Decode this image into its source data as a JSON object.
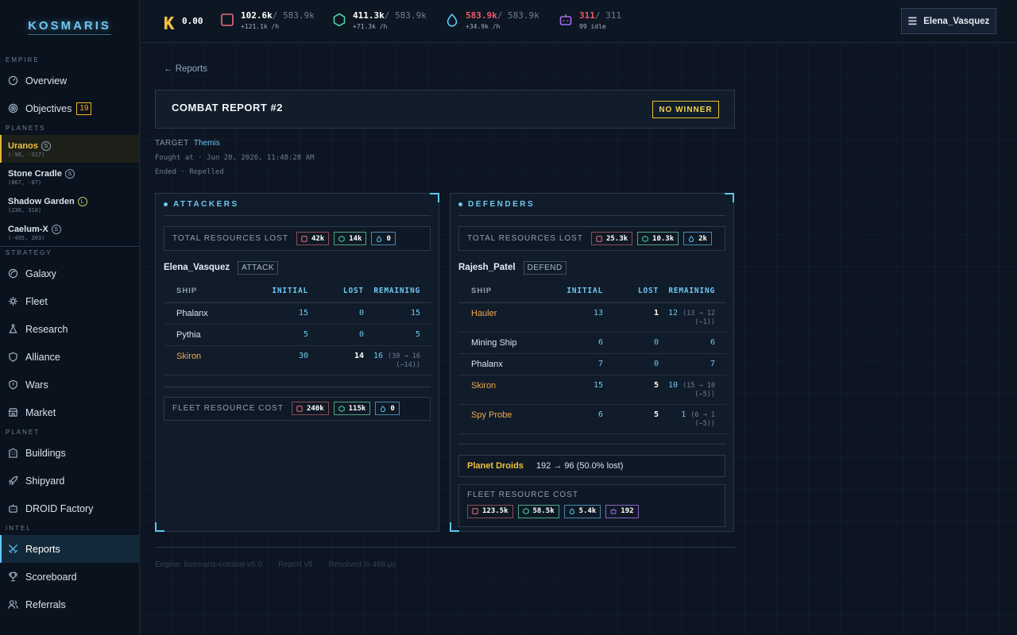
{
  "app": {
    "logo": "KOSMARIS"
  },
  "sidebar": {
    "sections": {
      "empire": "EMPIRE",
      "planets": "PLANETS",
      "strategy": "STRATEGY",
      "planet": "PLANET",
      "intel": "INTEL"
    },
    "overview": "Overview",
    "objectives": "Objectives",
    "objectives_badge": "19",
    "planets": [
      {
        "name": "Uranos",
        "size": "S",
        "coords": "(-96, -317)"
      },
      {
        "name": "Stone Cradle",
        "size": "S",
        "coords": "(867, -87)"
      },
      {
        "name": "Shadow Garden",
        "size": "L",
        "coords": "(230, 318)"
      },
      {
        "name": "Caelum-X",
        "size": "S",
        "coords": "(-495, 203)"
      }
    ],
    "strategy": [
      "Galaxy",
      "Fleet",
      "Research",
      "Alliance",
      "Wars",
      "Market"
    ],
    "planet_items": [
      "Buildings",
      "Shipyard",
      "DROID Factory"
    ],
    "intel": [
      "Reports",
      "Scoreboard",
      "Referrals"
    ]
  },
  "topbar": {
    "credits": "0.00",
    "metal": {
      "value": "102.6k",
      "cap": "/ 583.9k",
      "rate": "+121.1k /h"
    },
    "crystal": {
      "value": "411.3k",
      "cap": "/ 583.9k",
      "rate": "+71.3k /h"
    },
    "fuel": {
      "value": "583.9k",
      "cap": "/ 583.9k",
      "rate": "+34.9k /h"
    },
    "droids": {
      "value": "311",
      "cap": "/ 311",
      "rate": "99 idle"
    },
    "user": "Elena_Vasquez"
  },
  "report": {
    "back": "← Reports",
    "title": "COMBAT REPORT #2",
    "result": "NO WINNER",
    "target_label": "TARGET",
    "target": "Themis",
    "fought": "Fought at · Jun 20, 2026, 11:48:28 AM",
    "ended": "Ended · Repelled",
    "attackers": {
      "heading": "ATTACKERS",
      "lost_label": "TOTAL RESOURCES LOST",
      "lost": [
        "42k",
        "14k",
        "0"
      ],
      "player": "Elena_Vasquez",
      "role": "ATTACK",
      "cols": [
        "SHIP",
        "INITIAL",
        "LOST",
        "REMAINING"
      ],
      "rows": [
        {
          "ship": "Phalanx",
          "initial": "15",
          "lost": "0",
          "remaining": "15",
          "detail": "",
          "hl": false
        },
        {
          "ship": "Pythia",
          "initial": "5",
          "lost": "0",
          "remaining": "5",
          "detail": "",
          "hl": false
        },
        {
          "ship": "Skiron",
          "initial": "30",
          "lost": "14",
          "remaining": "16",
          "detail": "(30 → 16 (−14))",
          "hl": true
        }
      ],
      "cost_label": "FLEET RESOURCE COST",
      "cost": [
        "240k",
        "115k",
        "0"
      ]
    },
    "defenders": {
      "heading": "DEFENDERS",
      "lost_label": "TOTAL RESOURCES LOST",
      "lost": [
        "25.3k",
        "10.3k",
        "2k"
      ],
      "player": "Rajesh_Patel",
      "role": "DEFEND",
      "cols": [
        "SHIP",
        "INITIAL",
        "LOST",
        "REMAINING"
      ],
      "rows": [
        {
          "ship": "Hauler",
          "initial": "13",
          "lost": "1",
          "remaining": "12",
          "detail": "(13 → 12 (−1))",
          "hl": true
        },
        {
          "ship": "Mining Ship",
          "initial": "6",
          "lost": "0",
          "remaining": "6",
          "detail": "",
          "hl": false
        },
        {
          "ship": "Phalanx",
          "initial": "7",
          "lost": "0",
          "remaining": "7",
          "detail": "",
          "hl": false
        },
        {
          "ship": "Skiron",
          "initial": "15",
          "lost": "5",
          "remaining": "10",
          "detail": "(15 → 10 (−5))",
          "hl": true
        },
        {
          "ship": "Spy Probe",
          "initial": "6",
          "lost": "5",
          "remaining": "1",
          "detail": "(6 → 1 (−5))",
          "hl": true
        }
      ],
      "droids_label": "Planet Droids",
      "droids_value": "192 → 96 (50.0% lost)",
      "cost_label": "FLEET RESOURCE COST",
      "cost": [
        "123.5k",
        "58.5k",
        "5.4k",
        "192"
      ]
    },
    "footer": [
      "Engine: kosmaris-combat-v5.0",
      "Report v9",
      "Resolved in 468 μs"
    ]
  }
}
